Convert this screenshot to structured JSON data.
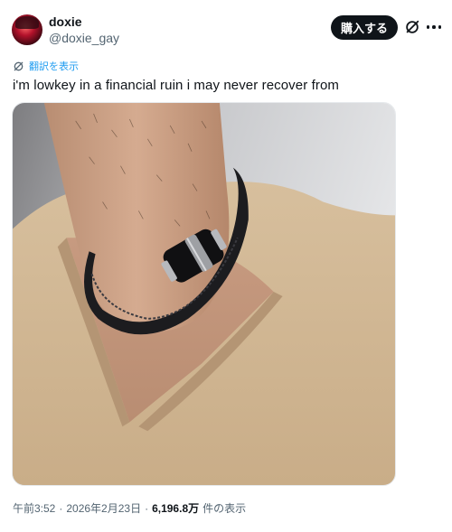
{
  "author": {
    "display_name": "doxie",
    "handle": "@doxie_gay"
  },
  "header": {
    "buy_label": "購入する",
    "grok_icon": "grok-slash-circle-icon",
    "more_icon": "more-dots-icon"
  },
  "translate": {
    "label": "翻訳を表示",
    "icon": "translate-icon"
  },
  "tweet": {
    "text": "i'm lowkey in a financial ruin i may never recover from"
  },
  "media": {
    "alt_icon": "photo-bracelet"
  },
  "meta": {
    "time": "午前3:52",
    "sep1": "·",
    "date": "2026年2月23日",
    "sep2": "·",
    "views_count": "6,196.8万",
    "views_label": "件の表示"
  },
  "colors": {
    "text_primary": "#0f1419",
    "text_secondary": "#536471",
    "link": "#1d9bf0",
    "button_bg": "#0f1419"
  }
}
